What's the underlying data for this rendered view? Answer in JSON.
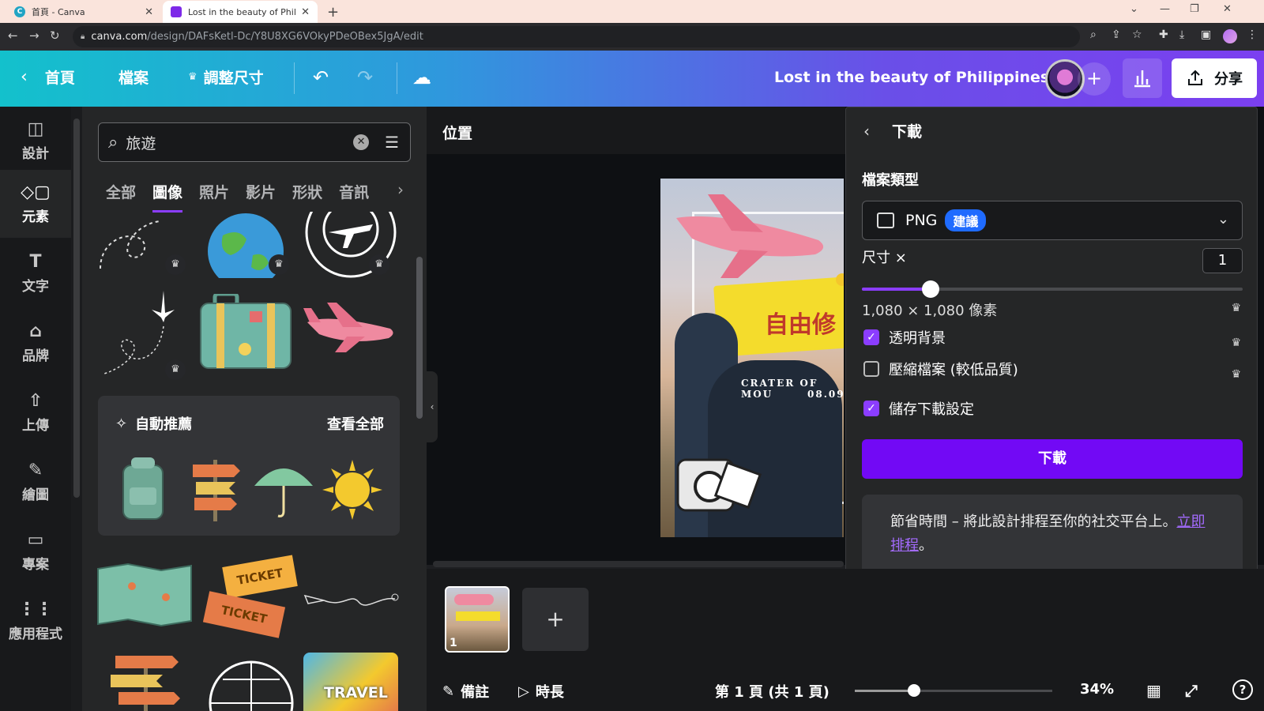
{
  "browser": {
    "tabs": [
      {
        "title": "首頁 - Canva",
        "active": false
      },
      {
        "title": "Lost in the beauty of Philippine",
        "active": true
      }
    ],
    "url_host": "canva.com",
    "url_path": "/design/DAFsKetl-Dc/Y8U8XG6VOkyPDeOBex5JgA/edit"
  },
  "header": {
    "home_label": "首頁",
    "file_label": "檔案",
    "resize_label": "調整尺寸",
    "design_title": "Lost in the beauty of Philippines",
    "share_label": "分享"
  },
  "rail": {
    "items": [
      {
        "label": "設計",
        "icon": "layout-icon"
      },
      {
        "label": "元素",
        "icon": "shapes-icon"
      },
      {
        "label": "文字",
        "icon": "text-icon"
      },
      {
        "label": "品牌",
        "icon": "brand-icon"
      },
      {
        "label": "上傳",
        "icon": "upload-icon"
      },
      {
        "label": "繪圖",
        "icon": "draw-icon"
      },
      {
        "label": "專案",
        "icon": "folder-icon"
      },
      {
        "label": "應用程式",
        "icon": "apps-icon"
      }
    ]
  },
  "panel": {
    "search_value": "旅遊",
    "categories": [
      "全部",
      "圖像",
      "照片",
      "影片",
      "形狀",
      "音訊"
    ],
    "active_category": "圖像",
    "auto_title": "自動推薦",
    "see_all": "查看全部",
    "ticket_text_1": "TICKET",
    "ticket_text_2": "TICKET",
    "travel_sticker_text": "TRAVEL"
  },
  "canvas": {
    "position_label": "位置",
    "art": {
      "headline": "自由修",
      "subline": "CRATER OF MOU",
      "date": "08.09"
    }
  },
  "download": {
    "title": "下載",
    "file_type_label": "檔案類型",
    "format": "PNG",
    "format_badge": "建議",
    "size_label": "尺寸 ×",
    "size_value": "1",
    "size_fraction": 0.18,
    "pixels": "1,080 × 1,080 像素",
    "options": [
      {
        "label": "透明背景",
        "checked": true,
        "premium": true
      },
      {
        "label": "壓縮檔案 (較低品質)",
        "checked": false,
        "premium": true
      }
    ],
    "save_settings_label": "儲存下載設定",
    "save_settings_checked": true,
    "button_label": "下載",
    "note_text": "節省時間 – 將此設計排程至你的社交平台上。",
    "note_link": "立即排程",
    "note_end": "。"
  },
  "pages": {
    "thumb_number": "1"
  },
  "bottom": {
    "notes_label": "備註",
    "duration_label": "時長",
    "page_indicator": "第 1 頁 (共 1 頁)",
    "zoom": "34%",
    "zoom_fraction": 0.3
  },
  "colors": {
    "accent": "#8b3dff",
    "download_button": "#7209f5",
    "badge": "#1f6bff"
  }
}
